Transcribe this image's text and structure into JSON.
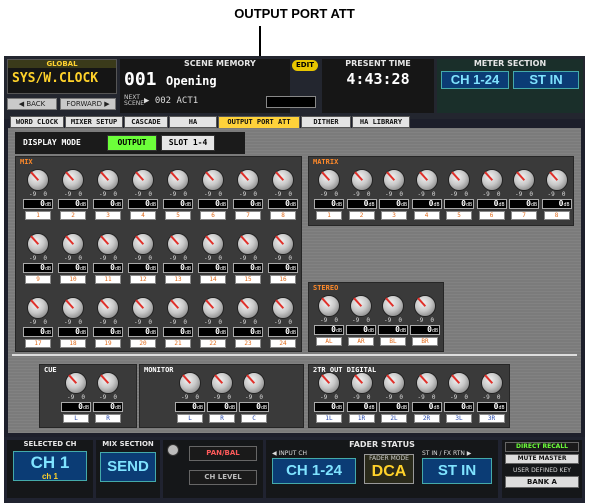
{
  "callout": "OUTPUT PORT ATT",
  "header": {
    "global_label": "GLOBAL",
    "global_value": "SYS/W.CLOCK",
    "back": "◀ BACK",
    "forward": "FORWARD ▶",
    "scene_label": "SCENE MEMORY",
    "scene_number": "001",
    "scene_name": "Opening",
    "next_label": "NEXT SCENE",
    "next_scene": "▶ 002 ACT1",
    "edit_badge": "EDIT",
    "time_label": "PRESENT TIME",
    "time_value": "4:43:28",
    "meter_label": "METER SECTION",
    "meter_ch": "CH 1-24",
    "meter_stin": "ST IN"
  },
  "tabs": [
    "WORD CLOCK",
    "MIXER SETUP",
    "CASCADE",
    "HA",
    "OUTPUT PORT ATT",
    "DITHER",
    "HA LIBRARY"
  ],
  "display_mode": {
    "label": "DISPLAY MODE",
    "output": "OUTPUT",
    "slot": "SLOT 1-4"
  },
  "knob": {
    "scale": "-9  0",
    "value": "0",
    "unit": "dB"
  },
  "groups": {
    "mix": {
      "title": "MIX",
      "channels": [
        "1",
        "2",
        "3",
        "4",
        "5",
        "6",
        "7",
        "8",
        "9",
        "10",
        "11",
        "12",
        "13",
        "14",
        "15",
        "16",
        "17",
        "18",
        "19",
        "20",
        "21",
        "22",
        "23",
        "24"
      ]
    },
    "matrix": {
      "title": "MATRIX",
      "channels": [
        "1",
        "2",
        "3",
        "4",
        "5",
        "6",
        "7",
        "8"
      ]
    },
    "stereo": {
      "title": "STEREO",
      "channels": [
        "AL",
        "AR",
        "BL",
        "BR"
      ]
    },
    "cue": {
      "title": "CUE",
      "channels": [
        "L",
        "R"
      ]
    },
    "monitor": {
      "title": "MONITOR",
      "channels": [
        "L",
        "R",
        "C"
      ]
    },
    "twotr": {
      "title": "2TR OUT DIGITAL",
      "channels": [
        "1L",
        "1R",
        "2L",
        "2R",
        "3L",
        "3R"
      ]
    }
  },
  "footer": {
    "selected_label": "SELECTED CH",
    "selected_ch": "CH 1",
    "selected_sub": "ch 1",
    "mix_label": "MIX SECTION",
    "mix_value": "SEND",
    "panbal": "PAN/BAL",
    "ch_level": "CH LEVEL",
    "fader_status": "FADER STATUS",
    "input_ch_label": "◀ INPUT CH",
    "input_ch": "CH 1-24",
    "fader_mode_label": "FADER MODE",
    "fader_mode": "DCA",
    "stin_label": "ST IN / FX RTN ▶",
    "stin": "ST IN",
    "direct_recall": "DIRECT RECALL",
    "mute_master": "MUTE MASTER",
    "user_key": "USER DEFINED KEY",
    "bank": "BANK A"
  },
  "colors": {
    "mix_title": "#ff8a2a",
    "matrix_title": "#ff8a2a",
    "stereo_title": "#ff8a2a",
    "white_title": "#ffffff",
    "channel_label": "#e06a1a",
    "white_label": "#2244aa",
    "active_tab": "#ffd23a",
    "output_active": "#6cff3a",
    "needle": "#e0302a"
  }
}
